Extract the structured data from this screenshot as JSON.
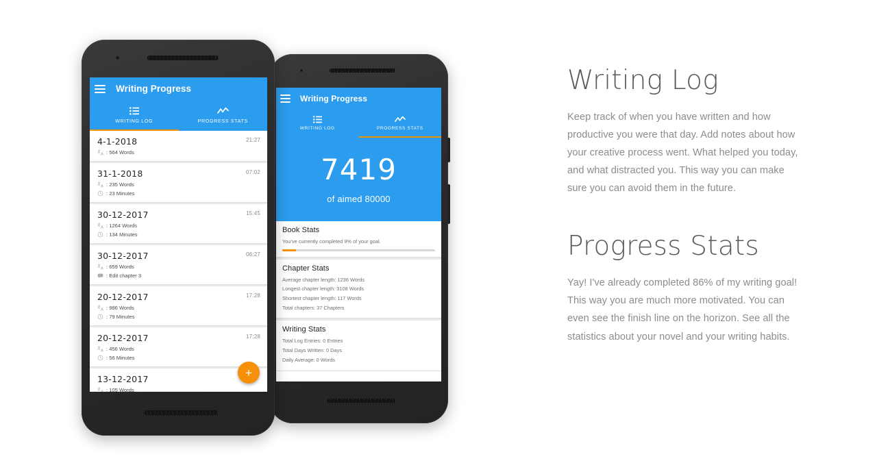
{
  "theme": {
    "blue": "#2b9cee",
    "orange": "#f39200",
    "fab_orange": "#f79009",
    "screen_bg": "#ffffff",
    "list_bg": "#e9e9e9",
    "body_text": "#8c8c8c",
    "heading_text": "#5a5a5a"
  },
  "app": {
    "title": "Writing Progress",
    "menu_icon": "hamburger-menu-icon",
    "tabs": [
      {
        "label": "Writing Log",
        "icon": "list-icon"
      },
      {
        "label": "Progress Stats",
        "icon": "line-chart-icon"
      }
    ]
  },
  "phone_left": {
    "active_tab_index": 0,
    "fab": {
      "label": "+",
      "icon": "plus-icon"
    },
    "log_entries": [
      {
        "date": "4-1-2018",
        "time": "21:27",
        "rows": [
          {
            "icon": "words-icon",
            "text": ": 564 Words"
          }
        ]
      },
      {
        "date": "31-1-2018",
        "time": "07:02",
        "rows": [
          {
            "icon": "words-icon",
            "text": ": 235 Words"
          },
          {
            "icon": "clock-icon",
            "text": ": 23 Minutes"
          }
        ]
      },
      {
        "date": "30-12-2017",
        "time": "15:45",
        "rows": [
          {
            "icon": "words-icon",
            "text": ": 1264 Words"
          },
          {
            "icon": "clock-icon",
            "text": ": 134 Minutes"
          }
        ]
      },
      {
        "date": "30-12-2017",
        "time": "06:27",
        "rows": [
          {
            "icon": "words-icon",
            "text": ": 659 Words"
          },
          {
            "icon": "note-icon",
            "text": ": Edit chapter 3"
          }
        ]
      },
      {
        "date": "20-12-2017",
        "time": "17:28",
        "rows": [
          {
            "icon": "words-icon",
            "text": ": 986 Words"
          },
          {
            "icon": "clock-icon",
            "text": ": 79 Minutes"
          }
        ]
      },
      {
        "date": "20-12-2017",
        "time": "17:28",
        "rows": [
          {
            "icon": "words-icon",
            "text": ": 456 Words"
          },
          {
            "icon": "clock-icon",
            "text": ": 56 Minutes"
          }
        ]
      },
      {
        "date": "13-12-2017",
        "time": "",
        "rows": [
          {
            "icon": "words-icon",
            "text": ": 105 Words"
          }
        ]
      }
    ]
  },
  "phone_right": {
    "active_tab_index": 1,
    "hero": {
      "count": "7419",
      "subtitle": "of aimed 80000"
    },
    "cards": [
      {
        "title": "Book Stats",
        "lines": [
          "You've currently completed 9% of your goal."
        ],
        "progress_percent": 9
      },
      {
        "title": "Chapter Stats",
        "lines": [
          "Average chapter length: 1236 Words",
          "Longest chapter length: 3108 Words",
          "Shortest chapter length: 117 Words",
          "Total chapters: 37 Chapters"
        ]
      },
      {
        "title": "Writing Stats",
        "lines": [
          "Total Log Entries: 0 Entries",
          "Total Days Written: 0 Days",
          "Daily Average: 0 Words"
        ]
      }
    ]
  },
  "copy": {
    "block_1": {
      "heading": "Writing Log",
      "paragraph": "Keep track of when you have written and how productive you were that day. Add notes about how your creative process went. What helped you today, and what distracted you. This way you can make sure you can avoid them in the future."
    },
    "block_2": {
      "heading": "Progress Stats",
      "paragraph": "Yay! I've already completed 86% of my writing goal! This way you are much more motivated. You can even see the finish line on the horizon. See all the statistics about your novel and your writing habits."
    }
  }
}
